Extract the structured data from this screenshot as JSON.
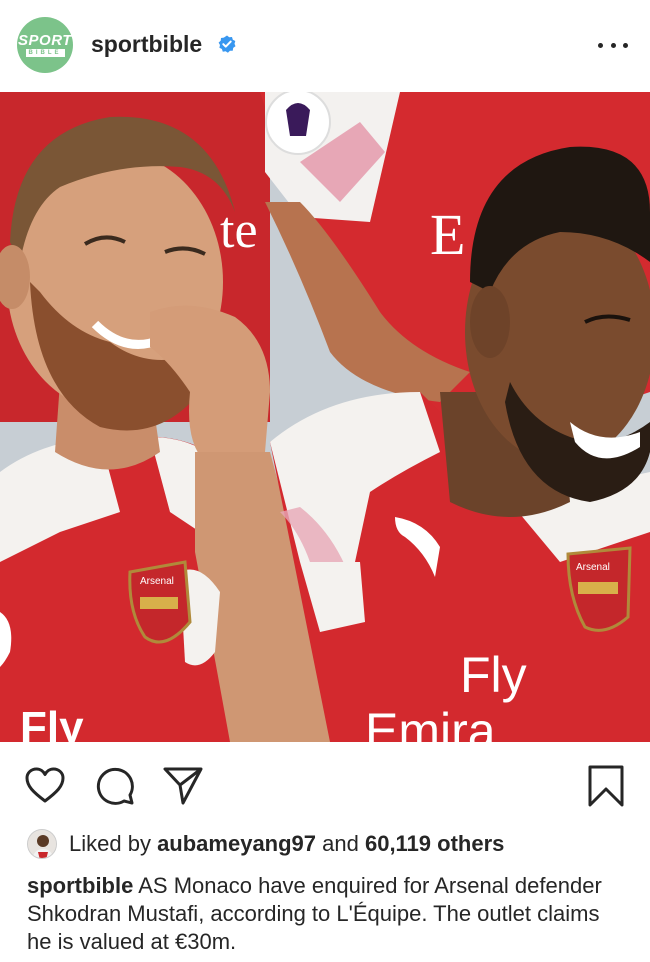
{
  "post": {
    "username": "sportbible",
    "avatar_logo_top": "SPORT",
    "avatar_logo_bottom": "BIBLE",
    "verified_icon": "verified-badge-icon",
    "more_icon": "more-options-icon"
  },
  "photo": {
    "jersey_sponsor_left": "Fly",
    "jersey_sponsor_right": "Fly",
    "jersey_sponsor_right_line2": "Emira",
    "crest_text_left": "Arsenal",
    "crest_text_right": "Arsenal",
    "shirt_text_back_left": "te",
    "shirt_text_back_right": "E"
  },
  "actions": {
    "like_icon": "heart-icon",
    "comment_icon": "comment-icon",
    "share_icon": "share-icon",
    "save_icon": "bookmark-icon"
  },
  "likes": {
    "prefix": "Liked by ",
    "user": "aubameyang97",
    "middle": " and ",
    "count": "60,119 others"
  },
  "caption": {
    "username": "sportbible",
    "text": " AS Monaco have enquired for Arsenal defender Shkodran Mustafi, according to L'Équipe. The outlet claims he is valued at €30m."
  },
  "colors": {
    "brand_green": "#7cc38a",
    "verified_blue": "#3897f0",
    "arsenal_red": "#d92b2f",
    "text": "#262626"
  }
}
